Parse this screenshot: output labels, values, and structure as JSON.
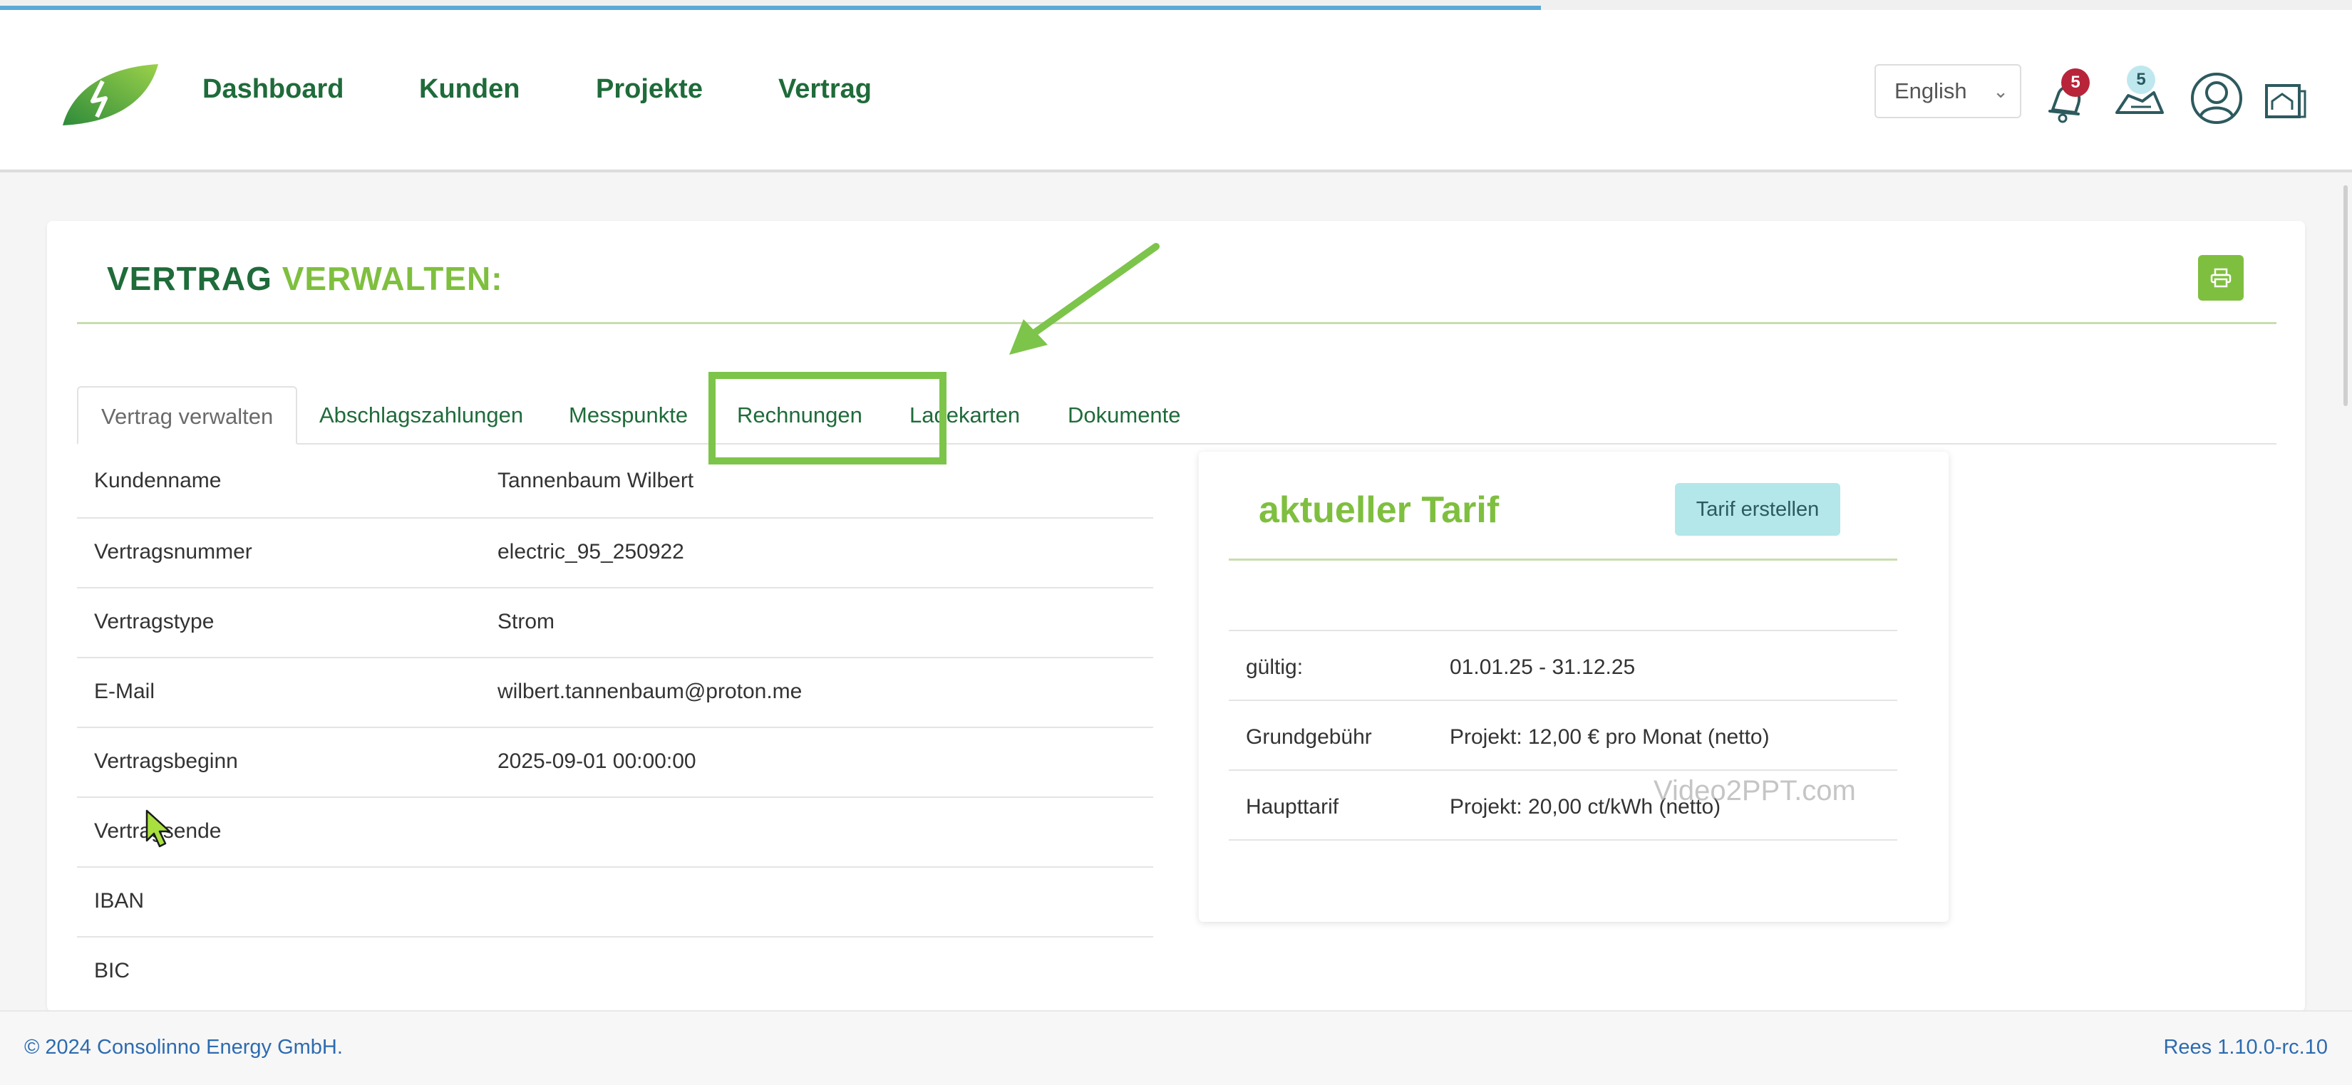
{
  "progress": {
    "fraction": 0.655
  },
  "header": {
    "nav": [
      "Dashboard",
      "Kunden",
      "Projekte",
      "Vertrag"
    ],
    "language": {
      "selected": "English"
    },
    "notifications_count": "5",
    "messages_count": "5",
    "icons": [
      "bell-icon",
      "map-icon",
      "user-circle-icon",
      "house-list-icon"
    ]
  },
  "page": {
    "title_part1": "VERTRAG",
    "title_part2": "VERWALTEN:",
    "print_icon": "printer-icon"
  },
  "tabs": [
    {
      "label": "Vertrag verwalten",
      "active": true
    },
    {
      "label": "Abschlagszahlungen",
      "active": false
    },
    {
      "label": "Messpunkte",
      "active": false
    },
    {
      "label": "Rechnungen",
      "active": false,
      "highlighted": true
    },
    {
      "label": "Ladekarten",
      "active": false
    },
    {
      "label": "Dokumente",
      "active": false
    }
  ],
  "contract": [
    {
      "label": "Kundenname",
      "value": "Tannenbaum Wilbert"
    },
    {
      "label": "Vertragsnummer",
      "value": "electric_95_250922"
    },
    {
      "label": "Vertragstype",
      "value": "Strom"
    },
    {
      "label": "E-Mail",
      "value": "wilbert.tannenbaum@proton.me"
    },
    {
      "label": "Vertragsbeginn",
      "value": "2025-09-01 00:00:00"
    },
    {
      "label": "Vertragsende",
      "value": ""
    },
    {
      "label": "IBAN",
      "value": ""
    },
    {
      "label": "BIC",
      "value": ""
    }
  ],
  "tariff": {
    "title": "aktueller Tarif",
    "button": "Tarif erstellen",
    "rows": [
      {
        "label": "gültig:",
        "value": "01.01.25 - 31.12.25"
      },
      {
        "label": "Grundgebühr",
        "value": "Projekt: 12,00 € pro Monat (netto)"
      },
      {
        "label": "Haupttarif",
        "value": "Projekt: 20,00 ct/kWh (netto)"
      }
    ]
  },
  "watermark": "Video2PPT.com",
  "footer": {
    "copyright": "© 2024 Consolinno Energy GmbH.",
    "version": "Rees 1.10.0-rc.10"
  },
  "colors": {
    "brand_dark_green": "#1f6b3a",
    "brand_light_green": "#7fbf3f",
    "highlight_green": "#7dc44b",
    "link_blue": "#2d6bb0",
    "badge_red": "#b8243a",
    "tariff_button": "#b4e7ea"
  }
}
